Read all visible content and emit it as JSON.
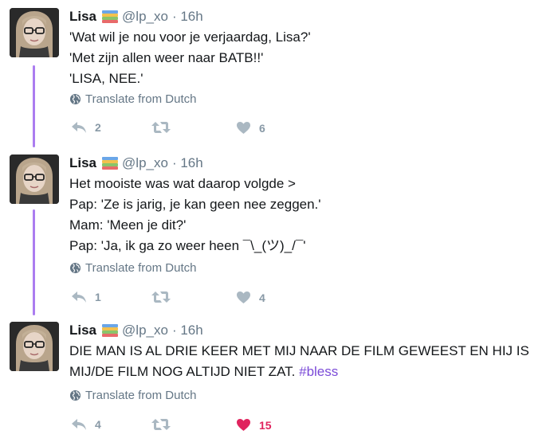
{
  "tweets": [
    {
      "name": "Lisa",
      "handle": "@lp_xo",
      "time": "· 16h",
      "lines": [
        "'Wat wil je nou voor je verjaardag, Lisa?'",
        "'Met zijn allen weer naar BATB!!'",
        "'LISA, NEE.'"
      ],
      "translate": "Translate from Dutch",
      "replies": "2",
      "retweets": "",
      "likes": "6",
      "liked": false
    },
    {
      "name": "Lisa",
      "handle": "@lp_xo",
      "time": "· 16h",
      "lines": [
        "Het mooiste was wat daarop volgde >",
        "Pap: 'Ze is jarig, je kan geen nee zeggen.'",
        "Mam: 'Meen je dit?'",
        "Pap: 'Ja, ik ga zo weer heen ¯\\_(ツ)_/¯'"
      ],
      "translate": "Translate from Dutch",
      "replies": "1",
      "retweets": "",
      "likes": "4",
      "liked": false
    },
    {
      "name": "Lisa",
      "handle": "@lp_xo",
      "time": "· 16h",
      "lines": [
        "DIE MAN IS AL DRIE KEER MET MIJ NAAR DE FILM GEWEEST EN HIJ IS",
        "MIJ/DE FILM NOG ALTIJD NIET ZAT."
      ],
      "hashtag": "#bless",
      "translate": "Translate from Dutch",
      "replies": "4",
      "retweets": "",
      "likes": "15",
      "liked": true
    }
  ],
  "icons": {
    "reply": "reply-icon",
    "retweet": "retweet-icon",
    "like": "heart-icon",
    "translate": "globe-icon",
    "name_emoji": "books-emoji"
  },
  "colors": {
    "thread_line": "#ab7df0",
    "hashtag": "#7b4bd8",
    "like_active": "#e0245e",
    "muted": "#8899a6"
  }
}
